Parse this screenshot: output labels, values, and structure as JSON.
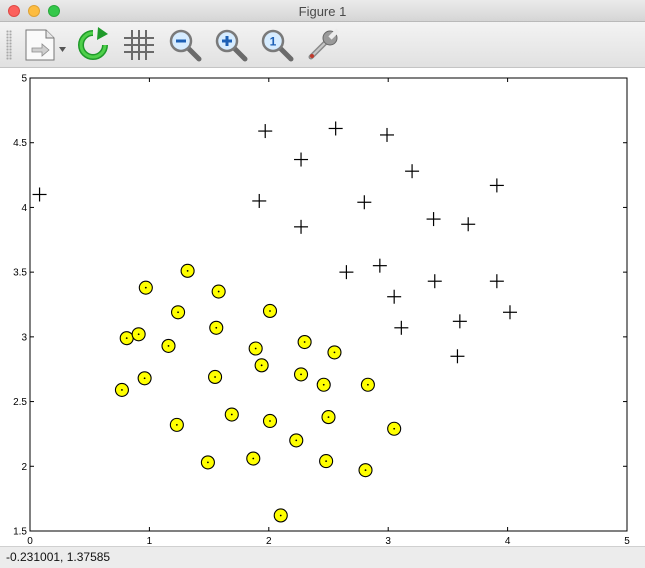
{
  "window": {
    "title": "Figure 1"
  },
  "toolbar": {
    "items": [
      {
        "id": "document-arrow",
        "icon": "document-arrow-icon"
      },
      {
        "id": "refresh",
        "icon": "refresh-icon"
      },
      {
        "id": "grid",
        "icon": "grid-icon"
      },
      {
        "id": "zoom-out",
        "icon": "zoom-out-icon"
      },
      {
        "id": "zoom-in",
        "icon": "zoom-in-icon"
      },
      {
        "id": "zoom-reset",
        "icon": "zoom-reset-icon",
        "label": "1"
      },
      {
        "id": "settings",
        "icon": "wrench-icon"
      }
    ]
  },
  "status": {
    "coords": "-0.231001,  1.37585"
  },
  "colors": {
    "marker_fill": "#ffff00",
    "marker_edge": "#000000",
    "background": "#ffffff"
  },
  "chart_data": {
    "type": "scatter",
    "xlim": [
      0,
      5
    ],
    "ylim": [
      1.5,
      5
    ],
    "x_ticks": [
      "0",
      "1",
      "2",
      "3",
      "4",
      "5"
    ],
    "y_ticks": [
      "1.5",
      "2",
      "2.5",
      "3",
      "3.5",
      "4",
      "4.5",
      "5"
    ],
    "grid": false,
    "series": [
      {
        "marker": "plus",
        "points": [
          [
            0.08,
            4.1
          ],
          [
            1.97,
            4.59
          ],
          [
            2.27,
            4.37
          ],
          [
            2.56,
            4.61
          ],
          [
            2.99,
            4.56
          ],
          [
            1.92,
            4.05
          ],
          [
            2.27,
            3.85
          ],
          [
            2.8,
            4.04
          ],
          [
            3.2,
            4.28
          ],
          [
            3.38,
            3.91
          ],
          [
            3.67,
            3.87
          ],
          [
            3.91,
            4.17
          ],
          [
            2.65,
            3.5
          ],
          [
            2.93,
            3.55
          ],
          [
            3.05,
            3.31
          ],
          [
            3.39,
            3.43
          ],
          [
            3.91,
            3.43
          ],
          [
            3.6,
            3.12
          ],
          [
            4.02,
            3.19
          ],
          [
            3.11,
            3.07
          ],
          [
            3.58,
            2.85
          ]
        ]
      },
      {
        "marker": "circle",
        "points": [
          [
            1.32,
            3.51
          ],
          [
            0.97,
            3.38
          ],
          [
            1.58,
            3.35
          ],
          [
            1.24,
            3.19
          ],
          [
            2.01,
            3.2
          ],
          [
            1.56,
            3.07
          ],
          [
            0.81,
            2.99
          ],
          [
            0.91,
            3.02
          ],
          [
            1.16,
            2.93
          ],
          [
            1.89,
            2.91
          ],
          [
            2.3,
            2.96
          ],
          [
            2.55,
            2.88
          ],
          [
            1.94,
            2.78
          ],
          [
            0.77,
            2.59
          ],
          [
            0.96,
            2.68
          ],
          [
            1.55,
            2.69
          ],
          [
            2.27,
            2.71
          ],
          [
            2.46,
            2.63
          ],
          [
            2.83,
            2.63
          ],
          [
            1.69,
            2.4
          ],
          [
            2.01,
            2.35
          ],
          [
            2.5,
            2.38
          ],
          [
            1.23,
            2.32
          ],
          [
            3.05,
            2.29
          ],
          [
            2.23,
            2.2
          ],
          [
            1.49,
            2.03
          ],
          [
            1.87,
            2.06
          ],
          [
            2.48,
            2.04
          ],
          [
            2.81,
            1.97
          ],
          [
            2.1,
            1.62
          ]
        ]
      }
    ]
  }
}
